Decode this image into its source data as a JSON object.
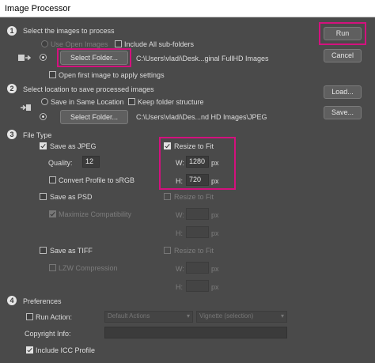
{
  "window": {
    "title": "Image Processor"
  },
  "section1": {
    "number": "1",
    "title": "Select the images to process",
    "use_open_images": "Use Open Images",
    "include_subfolders": "Include All sub-folders",
    "select_folder_button": "Select Folder...",
    "folder_path": "C:\\Users\\vladi\\Desk...ginal FullHD Images",
    "open_first_image": "Open first image to apply settings"
  },
  "section2": {
    "number": "2",
    "title": "Select location to save processed images",
    "save_in_same_location": "Save in Same Location",
    "keep_folder_structure": "Keep folder structure",
    "select_folder_button": "Select Folder...",
    "folder_path": "C:\\Users\\vladi\\Des...nd HD Images\\JPEG"
  },
  "section3": {
    "number": "3",
    "title": "File Type",
    "jpeg": {
      "save_as": "Save as JPEG",
      "quality_label": "Quality:",
      "quality_value": "12",
      "convert_profile": "Convert Profile to sRGB",
      "resize_to_fit": "Resize to Fit",
      "w_label": "W:",
      "w_value": "1280",
      "h_label": "H:",
      "h_value": "720",
      "unit": "px"
    },
    "psd": {
      "save_as": "Save as PSD",
      "maximize_compatibility": "Maximize Compatibility",
      "resize_to_fit": "Resize to Fit",
      "w_label": "W:",
      "h_label": "H:",
      "unit": "px"
    },
    "tiff": {
      "save_as": "Save as TIFF",
      "lzw_compression": "LZW Compression",
      "resize_to_fit": "Resize to Fit",
      "w_label": "W:",
      "h_label": "H:",
      "unit": "px"
    }
  },
  "section4": {
    "number": "4",
    "title": "Preferences",
    "run_action": "Run Action:",
    "action_set": "Default Actions",
    "action_name": "Vignette (selection)",
    "copyright_label": "Copyright Info:",
    "copyright_value": "",
    "include_icc": "Include ICC Profile"
  },
  "buttons": {
    "run": "Run",
    "cancel": "Cancel",
    "load": "Load...",
    "save": "Save..."
  },
  "colors": {
    "highlight": "#d4117e",
    "panel": "#4a4a4a"
  }
}
